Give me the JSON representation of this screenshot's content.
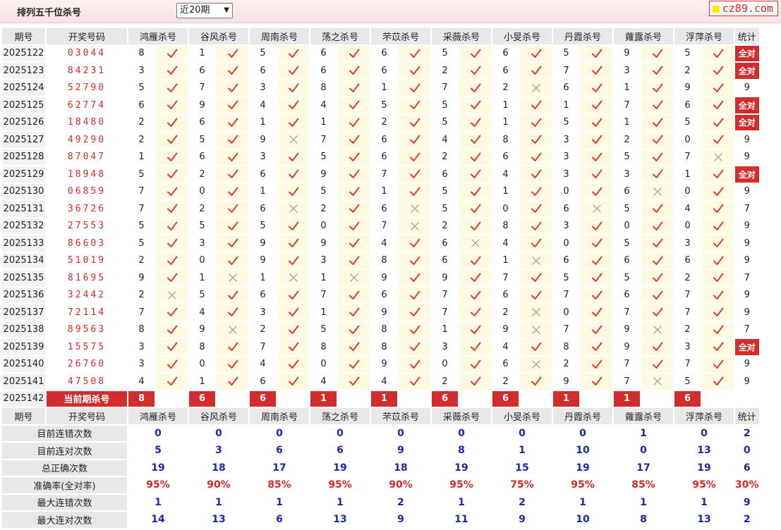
{
  "page_title": "排列五千位杀号",
  "period_select": "近20期",
  "logo": "cz89.com",
  "header": [
    "期号",
    "开奖号码",
    "鸿雁杀号",
    "谷风杀号",
    "周南杀号",
    "荡之杀号",
    "芣苡杀号",
    "采薇杀号",
    "小旻杀号",
    "丹霞杀号",
    "蕹露杀号",
    "浮萍杀号",
    "统计"
  ],
  "rows": [
    {
      "p": "2025122",
      "n": "03044",
      "k": [
        [
          8,
          1
        ],
        [
          1,
          1
        ],
        [
          5,
          1
        ],
        [
          6,
          1
        ],
        [
          6,
          1
        ],
        [
          5,
          1
        ],
        [
          6,
          1
        ],
        [
          5,
          1
        ],
        [
          9,
          1
        ],
        [
          5,
          1
        ]
      ],
      "s": "全对"
    },
    {
      "p": "2025123",
      "n": "84231",
      "k": [
        [
          3,
          1
        ],
        [
          6,
          1
        ],
        [
          6,
          1
        ],
        [
          6,
          1
        ],
        [
          6,
          1
        ],
        [
          2,
          1
        ],
        [
          6,
          1
        ],
        [
          7,
          1
        ],
        [
          3,
          1
        ],
        [
          2,
          1
        ]
      ],
      "s": "全对"
    },
    {
      "p": "2025124",
      "n": "52790",
      "k": [
        [
          5,
          1
        ],
        [
          7,
          1
        ],
        [
          3,
          1
        ],
        [
          8,
          1
        ],
        [
          1,
          1
        ],
        [
          7,
          1
        ],
        [
          2,
          0
        ],
        [
          6,
          1
        ],
        [
          1,
          1
        ],
        [
          9,
          1
        ]
      ],
      "s": "9"
    },
    {
      "p": "2025125",
      "n": "62774",
      "k": [
        [
          6,
          1
        ],
        [
          9,
          1
        ],
        [
          4,
          1
        ],
        [
          4,
          1
        ],
        [
          5,
          1
        ],
        [
          5,
          1
        ],
        [
          1,
          1
        ],
        [
          1,
          1
        ],
        [
          7,
          1
        ],
        [
          6,
          1
        ]
      ],
      "s": "全对"
    },
    {
      "p": "2025126",
      "n": "18480",
      "k": [
        [
          2,
          1
        ],
        [
          6,
          1
        ],
        [
          1,
          1
        ],
        [
          1,
          1
        ],
        [
          2,
          1
        ],
        [
          5,
          1
        ],
        [
          1,
          1
        ],
        [
          5,
          1
        ],
        [
          1,
          1
        ],
        [
          5,
          1
        ]
      ],
      "s": "全对"
    },
    {
      "p": "2025127",
      "n": "49290",
      "k": [
        [
          2,
          1
        ],
        [
          5,
          1
        ],
        [
          9,
          0
        ],
        [
          7,
          1
        ],
        [
          6,
          1
        ],
        [
          4,
          1
        ],
        [
          8,
          1
        ],
        [
          3,
          1
        ],
        [
          2,
          1
        ],
        [
          0,
          1
        ]
      ],
      "s": "9"
    },
    {
      "p": "2025128",
      "n": "87047",
      "k": [
        [
          1,
          1
        ],
        [
          6,
          1
        ],
        [
          3,
          1
        ],
        [
          5,
          1
        ],
        [
          6,
          1
        ],
        [
          2,
          1
        ],
        [
          6,
          1
        ],
        [
          3,
          1
        ],
        [
          5,
          1
        ],
        [
          7,
          0
        ]
      ],
      "s": "9"
    },
    {
      "p": "2025129",
      "n": "18948",
      "k": [
        [
          5,
          1
        ],
        [
          2,
          1
        ],
        [
          6,
          1
        ],
        [
          9,
          1
        ],
        [
          7,
          1
        ],
        [
          6,
          1
        ],
        [
          4,
          1
        ],
        [
          3,
          1
        ],
        [
          3,
          1
        ],
        [
          1,
          1
        ]
      ],
      "s": "全对"
    },
    {
      "p": "2025130",
      "n": "06859",
      "k": [
        [
          7,
          1
        ],
        [
          0,
          1
        ],
        [
          1,
          1
        ],
        [
          5,
          1
        ],
        [
          1,
          1
        ],
        [
          5,
          1
        ],
        [
          1,
          1
        ],
        [
          0,
          1
        ],
        [
          6,
          0
        ],
        [
          0,
          1
        ]
      ],
      "s": "9"
    },
    {
      "p": "2025131",
      "n": "36726",
      "k": [
        [
          7,
          1
        ],
        [
          2,
          1
        ],
        [
          6,
          0
        ],
        [
          2,
          1
        ],
        [
          6,
          0
        ],
        [
          5,
          1
        ],
        [
          0,
          1
        ],
        [
          6,
          0
        ],
        [
          5,
          1
        ],
        [
          4,
          1
        ]
      ],
      "s": "7"
    },
    {
      "p": "2025132",
      "n": "27553",
      "k": [
        [
          5,
          1
        ],
        [
          5,
          1
        ],
        [
          5,
          1
        ],
        [
          0,
          1
        ],
        [
          7,
          0
        ],
        [
          2,
          1
        ],
        [
          8,
          1
        ],
        [
          3,
          1
        ],
        [
          0,
          1
        ],
        [
          0,
          1
        ]
      ],
      "s": "9"
    },
    {
      "p": "2025133",
      "n": "86603",
      "k": [
        [
          5,
          1
        ],
        [
          3,
          1
        ],
        [
          9,
          1
        ],
        [
          9,
          1
        ],
        [
          4,
          1
        ],
        [
          6,
          0
        ],
        [
          4,
          1
        ],
        [
          0,
          1
        ],
        [
          5,
          1
        ],
        [
          3,
          1
        ]
      ],
      "s": "9"
    },
    {
      "p": "2025134",
      "n": "51019",
      "k": [
        [
          2,
          1
        ],
        [
          0,
          1
        ],
        [
          9,
          1
        ],
        [
          3,
          1
        ],
        [
          8,
          1
        ],
        [
          6,
          1
        ],
        [
          1,
          0
        ],
        [
          6,
          1
        ],
        [
          6,
          1
        ],
        [
          6,
          1
        ]
      ],
      "s": "9"
    },
    {
      "p": "2025135",
      "n": "81695",
      "k": [
        [
          9,
          1
        ],
        [
          1,
          0
        ],
        [
          1,
          0
        ],
        [
          1,
          0
        ],
        [
          9,
          1
        ],
        [
          9,
          1
        ],
        [
          7,
          1
        ],
        [
          5,
          1
        ],
        [
          5,
          1
        ],
        [
          2,
          1
        ]
      ],
      "s": "7"
    },
    {
      "p": "2025136",
      "n": "32442",
      "k": [
        [
          2,
          0
        ],
        [
          5,
          1
        ],
        [
          6,
          1
        ],
        [
          7,
          1
        ],
        [
          6,
          1
        ],
        [
          7,
          1
        ],
        [
          6,
          1
        ],
        [
          7,
          1
        ],
        [
          6,
          1
        ],
        [
          7,
          1
        ]
      ],
      "s": "9"
    },
    {
      "p": "2025137",
      "n": "72114",
      "k": [
        [
          7,
          1
        ],
        [
          4,
          1
        ],
        [
          3,
          1
        ],
        [
          1,
          1
        ],
        [
          9,
          1
        ],
        [
          7,
          1
        ],
        [
          2,
          0
        ],
        [
          0,
          1
        ],
        [
          7,
          1
        ],
        [
          7,
          1
        ]
      ],
      "s": "9"
    },
    {
      "p": "2025138",
      "n": "89563",
      "k": [
        [
          8,
          1
        ],
        [
          9,
          0
        ],
        [
          2,
          1
        ],
        [
          5,
          1
        ],
        [
          8,
          1
        ],
        [
          1,
          1
        ],
        [
          9,
          0
        ],
        [
          7,
          1
        ],
        [
          9,
          0
        ],
        [
          2,
          1
        ]
      ],
      "s": "7"
    },
    {
      "p": "2025139",
      "n": "15575",
      "k": [
        [
          3,
          1
        ],
        [
          8,
          1
        ],
        [
          7,
          1
        ],
        [
          8,
          1
        ],
        [
          8,
          1
        ],
        [
          3,
          1
        ],
        [
          4,
          1
        ],
        [
          8,
          1
        ],
        [
          9,
          1
        ],
        [
          3,
          1
        ]
      ],
      "s": "全对"
    },
    {
      "p": "2025140",
      "n": "26760",
      "k": [
        [
          3,
          1
        ],
        [
          0,
          1
        ],
        [
          4,
          1
        ],
        [
          0,
          1
        ],
        [
          9,
          1
        ],
        [
          0,
          1
        ],
        [
          6,
          0
        ],
        [
          2,
          1
        ],
        [
          7,
          1
        ],
        [
          7,
          1
        ]
      ],
      "s": "9"
    },
    {
      "p": "2025141",
      "n": "47508",
      "k": [
        [
          4,
          1
        ],
        [
          1,
          1
        ],
        [
          6,
          1
        ],
        [
          4,
          1
        ],
        [
          4,
          1
        ],
        [
          2,
          1
        ],
        [
          2,
          1
        ],
        [
          9,
          1
        ],
        [
          7,
          0
        ],
        [
          5,
          1
        ]
      ],
      "s": "9"
    }
  ],
  "current": {
    "p": "2025142",
    "label": "当前期杀号",
    "vals": [
      "8",
      "6",
      "6",
      "1",
      "1",
      "6",
      "6",
      "1",
      "1",
      "6"
    ]
  },
  "footer_header": [
    "期号",
    "开奖号码",
    "鸿雁杀号",
    "谷风杀号",
    "周南杀号",
    "荡之杀号",
    "芣苡杀号",
    "采薇杀号",
    "小旻杀号",
    "丹霞杀号",
    "蕹露杀号",
    "浮萍杀号",
    "统计"
  ],
  "stats": [
    {
      "label": "目前连错次数",
      "vals": [
        "0",
        "0",
        "0",
        "0",
        "0",
        "0",
        "0",
        "0",
        "1",
        "0",
        "2"
      ]
    },
    {
      "label": "目前连对次数",
      "vals": [
        "5",
        "3",
        "6",
        "6",
        "9",
        "8",
        "1",
        "10",
        "0",
        "13",
        "0"
      ]
    },
    {
      "label": "总正确次数",
      "vals": [
        "19",
        "18",
        "17",
        "19",
        "18",
        "19",
        "15",
        "19",
        "17",
        "19",
        "6"
      ]
    },
    {
      "label": "准确率(全对率)",
      "vals": [
        "95%",
        "90%",
        "85%",
        "95%",
        "90%",
        "95%",
        "75%",
        "95%",
        "85%",
        "95%",
        "30%"
      ],
      "pct": true
    },
    {
      "label": "最大连错次数",
      "vals": [
        "1",
        "1",
        "1",
        "1",
        "2",
        "1",
        "2",
        "1",
        "1",
        "1",
        "9"
      ]
    },
    {
      "label": "最大连对次数",
      "vals": [
        "14",
        "13",
        "6",
        "13",
        "9",
        "11",
        "9",
        "10",
        "8",
        "13",
        "2"
      ]
    }
  ],
  "colors": {
    "accent_red": "#d12d2d",
    "number_red": "#d42a2a",
    "stat_blue": "#1a2aa8",
    "check": "#e03a3a",
    "cross": "#a8a8a8"
  },
  "icons": {
    "right": "check-icon",
    "wrong": "cross-icon"
  }
}
